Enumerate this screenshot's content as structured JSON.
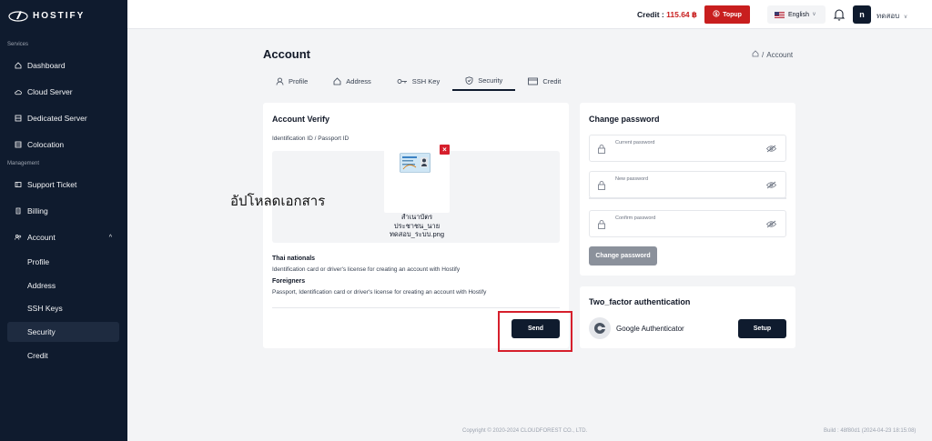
{
  "brand": {
    "name": "HOSTIFY"
  },
  "sidebar": {
    "section_services": "Services",
    "section_management": "Management",
    "items": [
      {
        "label": "Dashboard",
        "icon": "home-icon"
      },
      {
        "label": "Cloud Server",
        "icon": "cloud-icon"
      },
      {
        "label": "Dedicated Server",
        "icon": "server-icon"
      },
      {
        "label": "Colocation",
        "icon": "rack-icon"
      },
      {
        "label": "Support Ticket",
        "icon": "ticket-icon"
      },
      {
        "label": "Billing",
        "icon": "receipt-icon"
      },
      {
        "label": "Account",
        "icon": "users-icon"
      }
    ],
    "account_sub": [
      "Profile",
      "Address",
      "SSH Keys",
      "Security",
      "Credit"
    ],
    "active": "Security"
  },
  "topbar": {
    "credit_prefix": "Credit : ",
    "credit_amount": "115.64 ฿",
    "topup_label": "Topup",
    "language": "English",
    "avatar_letter": "n",
    "user_name": "ทดสอบ"
  },
  "page": {
    "title": "Account",
    "breadcrumb_current": "Account",
    "tabs": [
      "Profile",
      "Address",
      "SSH Key",
      "Security",
      "Credit"
    ],
    "active_tab": "Security"
  },
  "verify": {
    "title": "Account Verify",
    "id_label": "Identification ID / Passport ID",
    "file_name": "สำเนาบัตร\nประชาชน_นาย\nทดสอบ_ระบบ.png",
    "overlay_text": "อัปโหลดเอกสาร",
    "thai_heading": "Thai nationals",
    "thai_text": "Identification card or driver's license for creating an account with Hostify",
    "foreign_heading": "Foreigners",
    "foreign_text": "Passport, Identification card or driver's license for creating an account with Hostify",
    "send_label": "Send"
  },
  "password": {
    "title": "Change password",
    "current_label": "Current password",
    "new_label": "New password",
    "confirm_label": "Confirm password",
    "button_label": "Change password"
  },
  "twofa": {
    "title": "Two_factor authentication",
    "app_name": "Google Authenticator",
    "setup_label": "Setup"
  },
  "footer": {
    "copyright": "Copyright © 2020-2024 CLOUDFOREST CO., LTD.",
    "build": "Build : 48f80d1 (2024-04-23 18:15:08)"
  },
  "colors": {
    "sidebar": "#0f1b2e",
    "accent_red": "#c81e1e",
    "primary": "#0f1b2e"
  }
}
